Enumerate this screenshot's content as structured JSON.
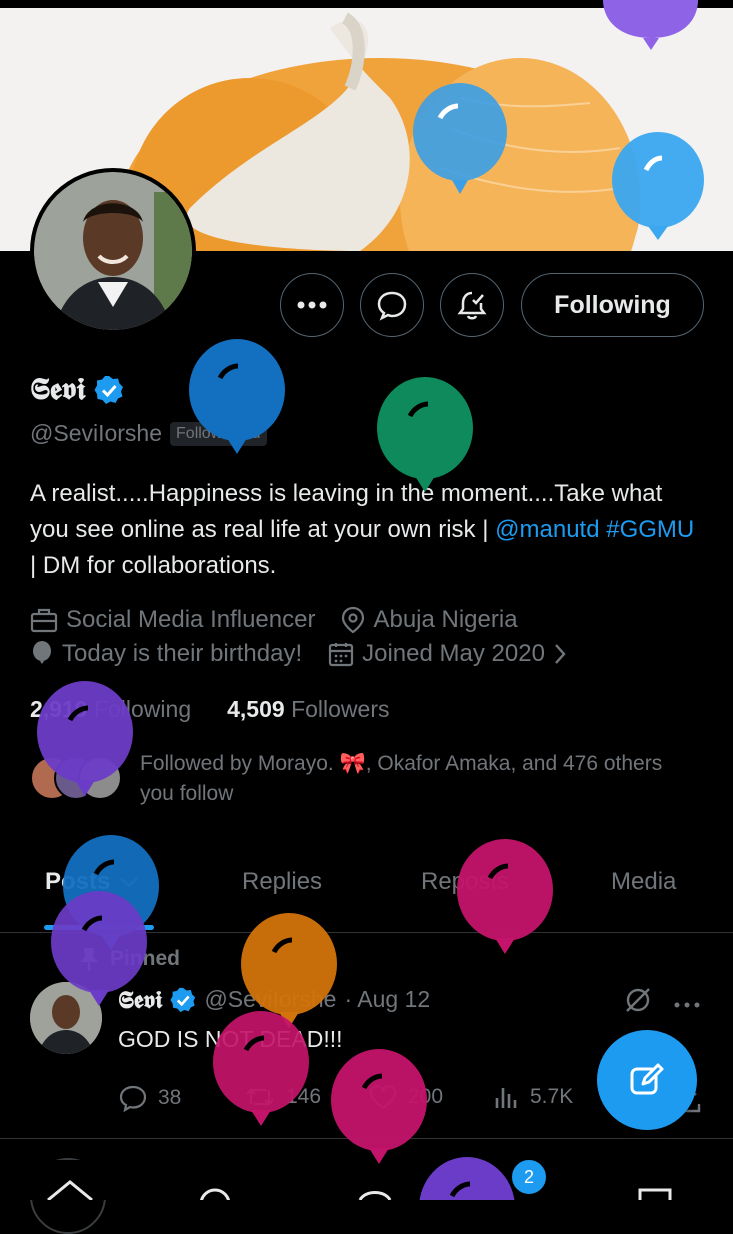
{
  "profile": {
    "name": "𝕾𝖊𝖛𝖎",
    "handle": "@SeviIorshe",
    "follows_you": "Follows you",
    "bio_parts": [
      "A realist.....Happiness is leaving in the moment....Take what you see online as real life at your own risk | ",
      "@manutd",
      " ",
      "#GGMU",
      " | DM for collaborations."
    ],
    "category": "Social Media Influencer",
    "location": "Abuja Nigeria",
    "birthday": "Today is their birthday!",
    "joined": "Joined May 2020",
    "following_count": "2,919",
    "following_label": "Following",
    "followers_count": "4,509",
    "followers_label": "Followers",
    "followed_by": "Followed by Morayo. 🎀, Okafor Amaka, and 476 others you follow"
  },
  "buttons": {
    "following": "Following"
  },
  "tabs": [
    {
      "label": "Posts"
    },
    {
      "label": "Replies"
    },
    {
      "label": "Reposts"
    },
    {
      "label": "Media"
    }
  ],
  "pinned_post": {
    "pinned_label": "Pinned",
    "author": "𝕾𝖊𝖛𝖎",
    "handle": "@SeviIorshe",
    "date": "· Aug 12",
    "text": "GOD IS NOT DEAD!!!",
    "replies": "38",
    "reposts": "146",
    "likes": "200",
    "views": "5.7K"
  },
  "notifications_badge": "2",
  "colors": {
    "accent": "#1d9bf0",
    "background": "#000000",
    "secondary_text": "#71767b",
    "balloon_purple": "#7b4fd6",
    "balloon_blue": "#1d9bf0",
    "balloon_green": "#0e8a5c",
    "balloon_magenta": "#c4136a",
    "balloon_orange": "#d2730b"
  }
}
